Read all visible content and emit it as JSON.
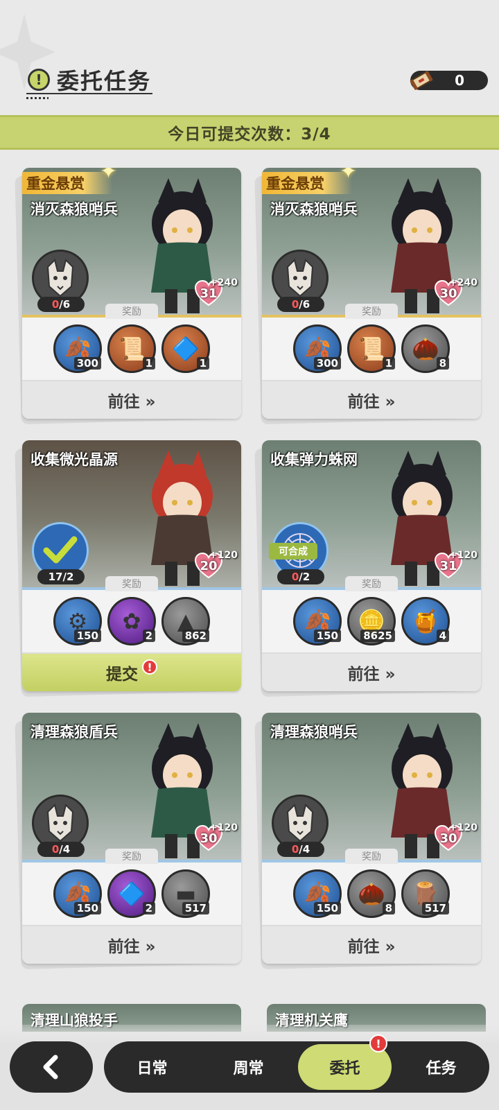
{
  "header": {
    "title": "委托任务",
    "title_icon": "!",
    "scroll_count": "0"
  },
  "daily_bar": {
    "text": "今日可提交次数：3/4"
  },
  "reward_label": "奖励",
  "cards": [
    {
      "bounty": "重金悬赏",
      "title": "消灭森狼哨兵",
      "progress_current": "0",
      "progress_total": "/6",
      "heart_value": "31",
      "bonus": "+240",
      "rewards": [
        {
          "icon": "leaf-icon",
          "glyph": "🍂",
          "count": "300",
          "color": "r-blue"
        },
        {
          "icon": "scroll-icon",
          "glyph": "📜",
          "count": "1",
          "color": "r-orange"
        },
        {
          "icon": "crystal-icon",
          "glyph": "🔷",
          "count": "1",
          "color": "r-orange"
        }
      ],
      "button": "前往 »"
    },
    {
      "bounty": "重金悬赏",
      "title": "消灭森狼哨兵",
      "progress_current": "0",
      "progress_total": "/6",
      "heart_value": "30",
      "bonus": "+240",
      "rewards": [
        {
          "icon": "leaf-icon",
          "glyph": "🍂",
          "count": "300",
          "color": "r-blue"
        },
        {
          "icon": "scroll-icon",
          "glyph": "📜",
          "count": "1",
          "color": "r-orange"
        },
        {
          "icon": "nuts-icon",
          "glyph": "🌰",
          "count": "8",
          "color": "r-gray"
        }
      ],
      "button": "前往 »"
    },
    {
      "title": "收集微光晶源",
      "progress_current": "17",
      "progress_total": "/2",
      "heart_value": "20",
      "bonus": "+120",
      "rewards": [
        {
          "icon": "gear-icon",
          "glyph": "⚙",
          "count": "150",
          "color": "r-blue"
        },
        {
          "icon": "flower-icon",
          "glyph": "✿",
          "count": "2",
          "color": "r-purple"
        },
        {
          "icon": "sand-pile-icon",
          "glyph": "▲",
          "count": "862",
          "color": "r-gray"
        }
      ],
      "button": "提交"
    },
    {
      "title": "收集弹力蛛网",
      "combine": "可合成",
      "progress_current": "0",
      "progress_total": "/2",
      "heart_value": "31",
      "bonus": "+120",
      "rewards": [
        {
          "icon": "leaf-icon",
          "glyph": "🍂",
          "count": "150",
          "color": "r-blue"
        },
        {
          "icon": "coin-icon",
          "glyph": "🪙",
          "count": "8625",
          "color": "r-gray"
        },
        {
          "icon": "honey-jar-icon",
          "glyph": "🍯",
          "count": "4",
          "color": "r-blue"
        }
      ],
      "button": "前往 »"
    },
    {
      "title": "清理森狼盾兵",
      "progress_current": "0",
      "progress_total": "/4",
      "heart_value": "30",
      "bonus": "+120",
      "rewards": [
        {
          "icon": "leaf-icon",
          "glyph": "🍂",
          "count": "150",
          "color": "r-blue"
        },
        {
          "icon": "crystal-icon",
          "glyph": "🔷",
          "count": "2",
          "color": "r-purple"
        },
        {
          "icon": "iron-bar-icon",
          "glyph": "▬",
          "count": "517",
          "color": "r-gray"
        }
      ],
      "button": "前往 »"
    },
    {
      "title": "清理森狼哨兵",
      "progress_current": "0",
      "progress_total": "/4",
      "heart_value": "30",
      "bonus": "+120",
      "rewards": [
        {
          "icon": "leaf-icon",
          "glyph": "🍂",
          "count": "150",
          "color": "r-blue"
        },
        {
          "icon": "nuts-icon",
          "glyph": "🌰",
          "count": "8",
          "color": "r-gray"
        },
        {
          "icon": "wood-logs-icon",
          "glyph": "🪵",
          "count": "517",
          "color": "r-gray"
        }
      ],
      "button": "前往 »"
    }
  ],
  "partial_cards": [
    "清理山狼投手",
    "清理机关鹰"
  ],
  "nav": {
    "tabs": [
      "日常",
      "周常",
      "委托",
      "任务"
    ],
    "active_tab": "委托",
    "badge": "!"
  }
}
